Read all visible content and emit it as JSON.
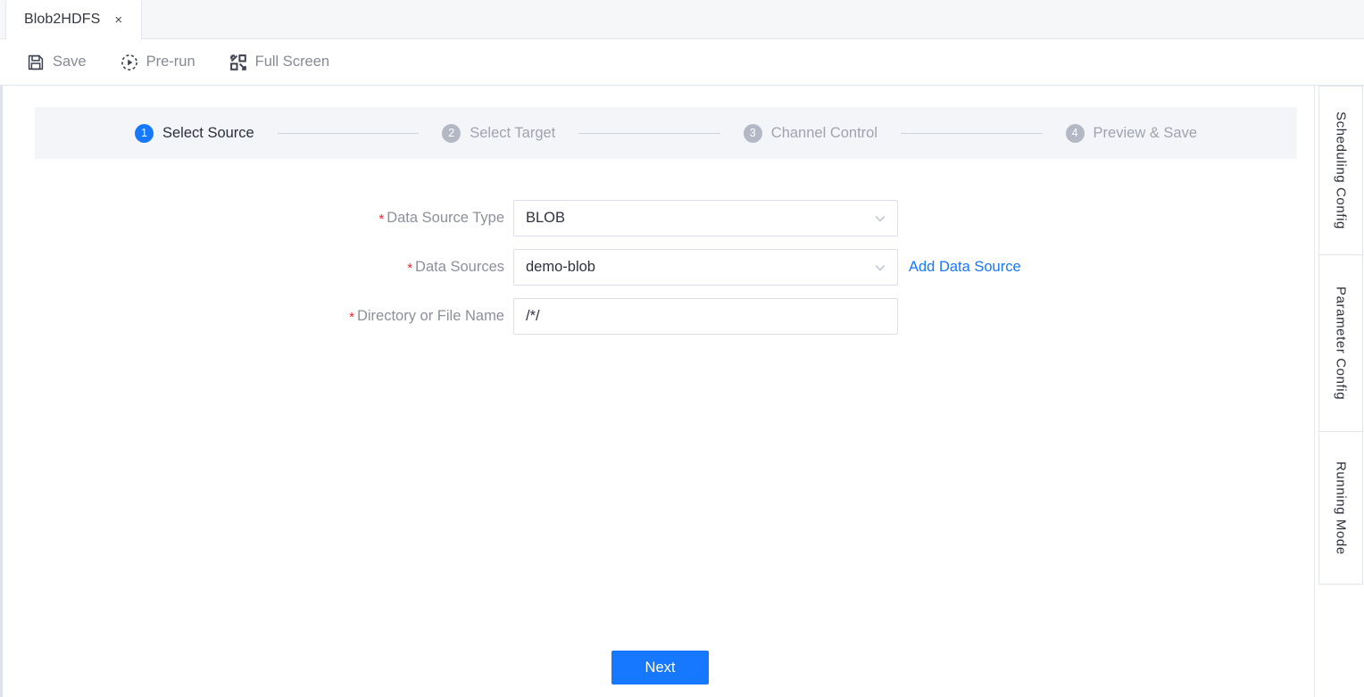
{
  "window": {
    "tab": {
      "title": "Blob2HDFS",
      "close": "×"
    }
  },
  "toolbar": {
    "items": [
      {
        "label": "Save",
        "icon": "save-icon"
      },
      {
        "label": "Pre-run",
        "icon": "prerun-play-icon"
      },
      {
        "label": "Full Screen",
        "icon": "full-screen-icon"
      }
    ]
  },
  "steps": [
    {
      "num": "1",
      "label": "Select Source",
      "active": true
    },
    {
      "num": "2",
      "label": "Select Target",
      "active": false
    },
    {
      "num": "3",
      "label": "Channel Control",
      "active": false
    },
    {
      "num": "4",
      "label": "Preview & Save",
      "active": false
    }
  ],
  "form": {
    "required_mark": "*",
    "fields": [
      {
        "label": "Data Source Type",
        "value": "BLOB",
        "type": "select",
        "required": true
      },
      {
        "label": "Data Sources",
        "value": "demo-blob",
        "type": "select",
        "required": true,
        "link": "Add Data Source"
      },
      {
        "label": "Directory or File Name",
        "value": "/*/",
        "type": "text",
        "required": true
      }
    ]
  },
  "footer": {
    "next_label": "Next"
  },
  "side_tabs": [
    {
      "label": "Scheduling Config"
    },
    {
      "label": "Parameter Config"
    },
    {
      "label": "Running Mode"
    }
  ],
  "colors": {
    "accent": "#1677ff",
    "required": "#f5222d",
    "step_inactive": "#b4b8c4",
    "step_bar_bg": "#f4f5f8",
    "muted_text": "#8d909b"
  }
}
